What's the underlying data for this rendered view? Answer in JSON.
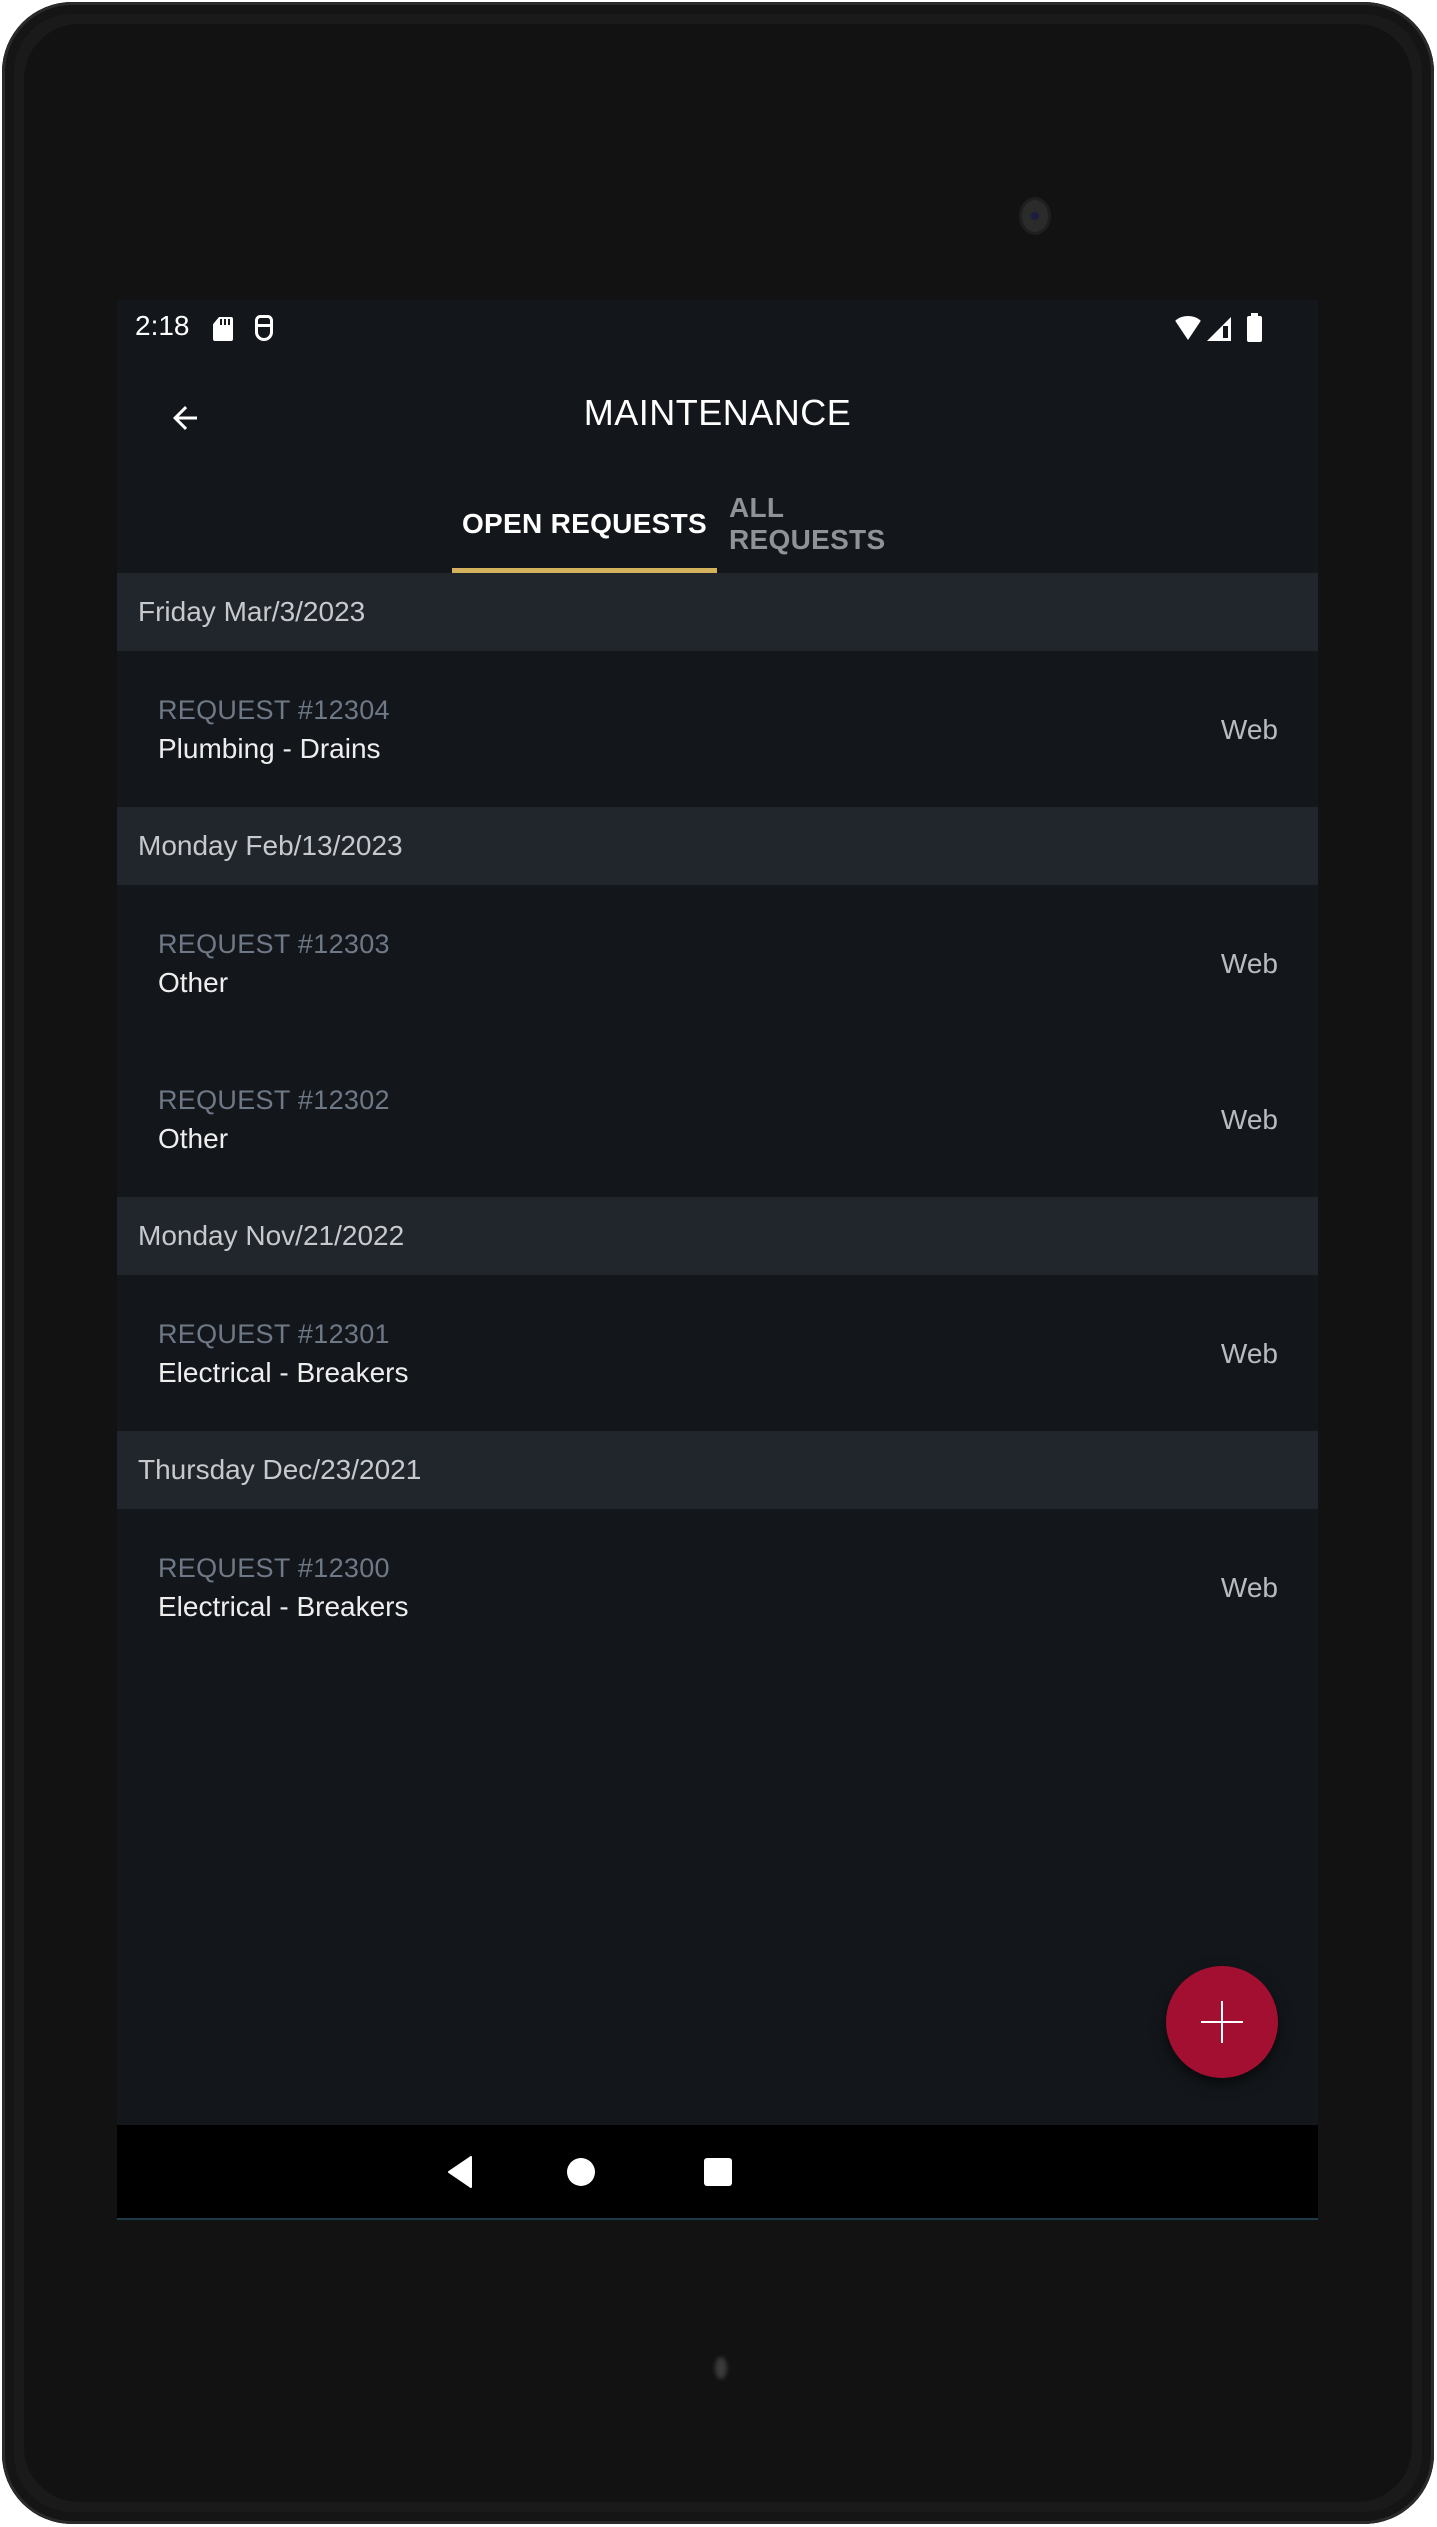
{
  "status_bar": {
    "time": "2:18",
    "left_icons": [
      "sd-card-icon",
      "android-debug-icon"
    ],
    "right_icons": [
      "wifi-icon",
      "cell-signal-icon",
      "battery-icon"
    ]
  },
  "app_bar": {
    "back_icon": "arrow-left-icon",
    "title": "MAINTENANCE"
  },
  "tabs": [
    {
      "label": "OPEN REQUESTS",
      "active": true
    },
    {
      "label": "ALL REQUESTS",
      "active": false
    }
  ],
  "sections": [
    {
      "date": "Friday Mar/3/2023",
      "items": [
        {
          "request": "REQUEST #12304",
          "category": "Plumbing - Drains",
          "source": "Web"
        }
      ]
    },
    {
      "date": "Monday Feb/13/2023",
      "items": [
        {
          "request": "REQUEST #12303",
          "category": "Other",
          "source": "Web"
        },
        {
          "request": "REQUEST #12302",
          "category": "Other",
          "source": "Web"
        }
      ]
    },
    {
      "date": "Monday Nov/21/2022",
      "items": [
        {
          "request": "REQUEST #12301",
          "category": "Electrical - Breakers",
          "source": "Web"
        }
      ]
    },
    {
      "date": "Thursday Dec/23/2021",
      "items": [
        {
          "request": "REQUEST #12300",
          "category": "Electrical - Breakers",
          "source": "Web"
        }
      ]
    }
  ],
  "fab": {
    "icon": "plus-icon",
    "color": "#a30f31"
  },
  "nav_bar": {
    "buttons": [
      "back-triangle-icon",
      "home-circle-icon",
      "recents-square-icon"
    ]
  },
  "colors": {
    "background": "#13171b",
    "section_header_bg": "#21252c",
    "tab_indicator": "#d4b25e",
    "request_id_text": "#6f7886",
    "accent_fab": "#a30f31"
  }
}
